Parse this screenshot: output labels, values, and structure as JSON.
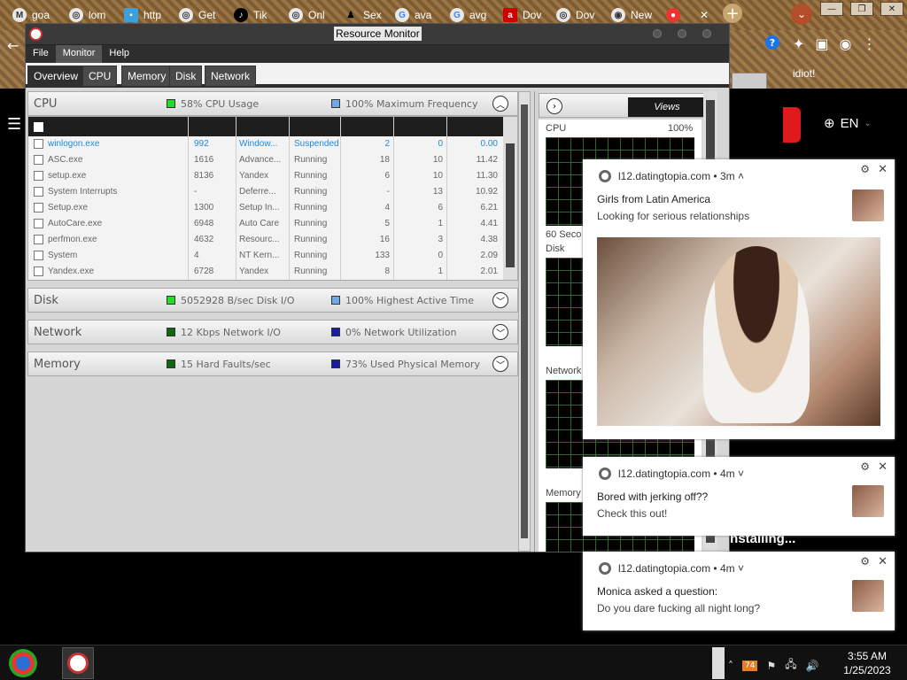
{
  "browser": {
    "tabs": [
      {
        "label": "goa",
        "icon": "gmail-icon"
      },
      {
        "label": "lom",
        "icon": "globe-icon"
      },
      {
        "label": "http",
        "icon": "page-icon"
      },
      {
        "label": "Get",
        "icon": "globe-icon"
      },
      {
        "label": "Tik",
        "icon": "tiktok-icon"
      },
      {
        "label": "Onl",
        "icon": "globe-icon"
      },
      {
        "label": "Sex",
        "icon": "figure-icon"
      },
      {
        "label": "ava",
        "icon": "google-icon"
      },
      {
        "label": "avg",
        "icon": "google-icon"
      },
      {
        "label": "Dov",
        "icon": "avira-icon"
      },
      {
        "label": "Dov",
        "icon": "globe-icon"
      },
      {
        "label": "New",
        "icon": "chrome-icon"
      }
    ],
    "page_snippet": "idiot!",
    "language": "EN",
    "installing_text": "installing..."
  },
  "resource_monitor": {
    "title": "Resource Monitor",
    "menu": [
      "File",
      "Monitor",
      "Help"
    ],
    "tabs": [
      "Overview",
      "CPU",
      "Memory",
      "Disk",
      "Network"
    ],
    "active_tab": "Overview",
    "cpu": {
      "name": "CPU",
      "usage_text": "58% CPU Usage",
      "freq_text": "100% Maximum Frequency",
      "rows": [
        [
          "winlogon.exe",
          "992",
          "Window...",
          "Suspended",
          "2",
          "0",
          "0.00"
        ],
        [
          "ASC.exe",
          "1616",
          "Advance...",
          "Running",
          "18",
          "10",
          "11.42"
        ],
        [
          "setup.exe",
          "8136",
          "Yandex",
          "Running",
          "6",
          "10",
          "11.30"
        ],
        [
          "System Interrupts",
          "-",
          "Deferre...",
          "Running",
          "-",
          "13",
          "10.92"
        ],
        [
          "Setup.exe",
          "1300",
          "Setup In...",
          "Running",
          "4",
          "6",
          "6.21"
        ],
        [
          "AutoCare.exe",
          "6948",
          "Auto Care",
          "Running",
          "5",
          "1",
          "4.41"
        ],
        [
          "perfmon.exe",
          "4632",
          "Resourc...",
          "Running",
          "16",
          "3",
          "4.38"
        ],
        [
          "System",
          "4",
          "NT Kern...",
          "Running",
          "133",
          "0",
          "2.09"
        ],
        [
          "Yandex.exe",
          "6728",
          "Yandex",
          "Running",
          "8",
          "1",
          "2.01"
        ]
      ]
    },
    "disk": {
      "name": "Disk",
      "io_text": "5052928 B/sec Disk I/O",
      "active_text": "100% Highest Active Time"
    },
    "network": {
      "name": "Network",
      "io_text": "12 Kbps Network I/O",
      "util_text": "0% Network Utilization"
    },
    "memory": {
      "name": "Memory",
      "faults_text": "15 Hard Faults/sec",
      "used_text": "73% Used Physical Memory"
    },
    "views_label": "Views",
    "graphs": {
      "cpu_label": "CPU",
      "cpu_pct": "100%",
      "seconds_label": "60 Seco",
      "disk_label": "Disk",
      "network_label": "Network",
      "memory_label": "Memory"
    },
    "colors": {
      "green": "#22dd22",
      "blue": "#6fa8e6",
      "dark_green": "#116611",
      "dark_blue": "#1a1aa8"
    }
  },
  "notifications": [
    {
      "source": "l12.datingtopia.com",
      "time": "3m",
      "title": "Girls from Latin America",
      "body": "Looking for serious relationships"
    },
    {
      "source": "l12.datingtopia.com",
      "time": "4m",
      "title": "Bored with jerking off??",
      "body": "Check this out!"
    },
    {
      "source": "l12.datingtopia.com",
      "time": "4m",
      "title": "Monica asked a question:",
      "body": "Do you dare fucking all night long?"
    }
  ],
  "taskbar": {
    "clock_time": "3:55 AM",
    "clock_date": "1/25/2023",
    "tray_badge": "74"
  }
}
